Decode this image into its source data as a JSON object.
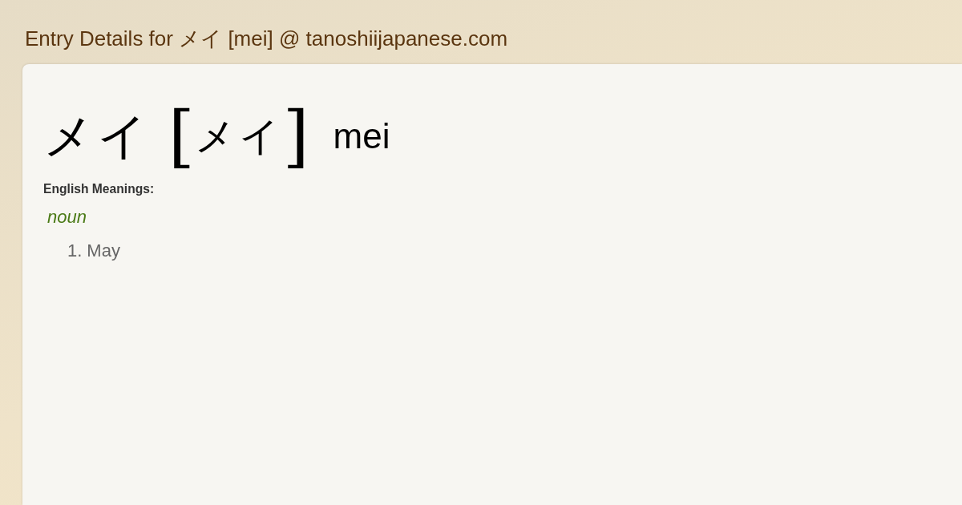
{
  "page_title": "Entry Details for メイ [mei] @ tanoshiijapanese.com",
  "entry": {
    "word": "メイ",
    "reading_open": "[",
    "reading": "メイ",
    "reading_close": "]",
    "romaji": "mei"
  },
  "meanings_label": "English Meanings:",
  "senses": [
    {
      "pos": "noun",
      "items": [
        {
          "number": "1.",
          "text": "May"
        }
      ]
    }
  ]
}
